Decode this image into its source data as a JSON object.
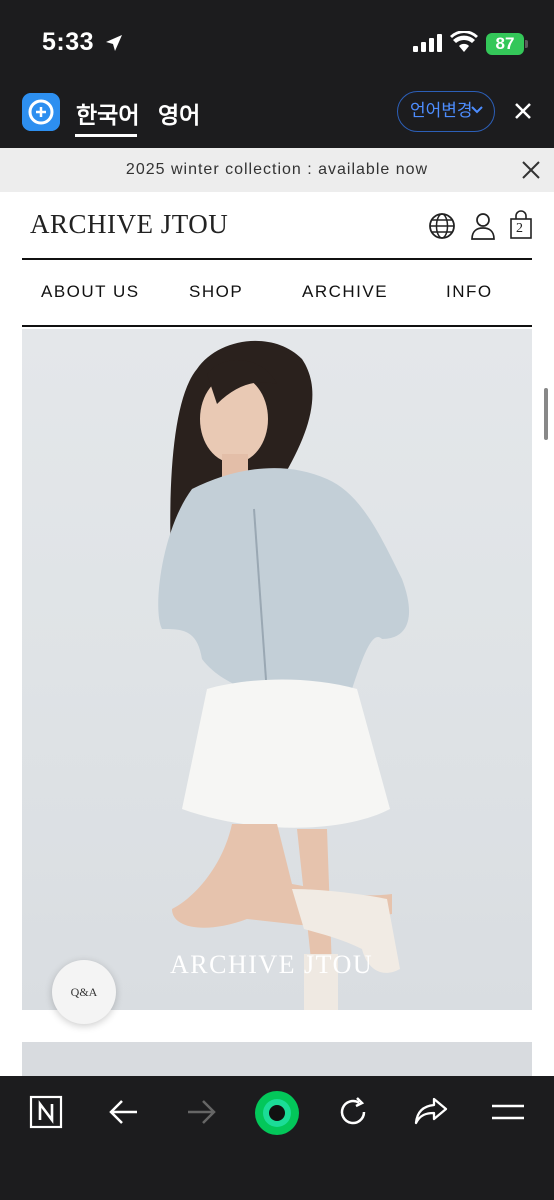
{
  "status_bar": {
    "time": "5:33",
    "battery": "87"
  },
  "translate_bar": {
    "source_lang": "한국어",
    "target_lang": "영어",
    "change_button": "언어변경"
  },
  "banner": {
    "text": "2025 winter collection : available now"
  },
  "site": {
    "logo": "ARCHIVE JTOU",
    "cart_count": "2",
    "nav": [
      "ABOUT US",
      "SHOP",
      "ARCHIVE",
      "INFO"
    ]
  },
  "hero": {
    "overlay_logo": "ARCHIVE JTOU"
  },
  "qna_button": "Q&A",
  "colors": {
    "accent_blue": "#4d8dff",
    "battery_green": "#34c759",
    "naver_green": "#03c75a"
  }
}
